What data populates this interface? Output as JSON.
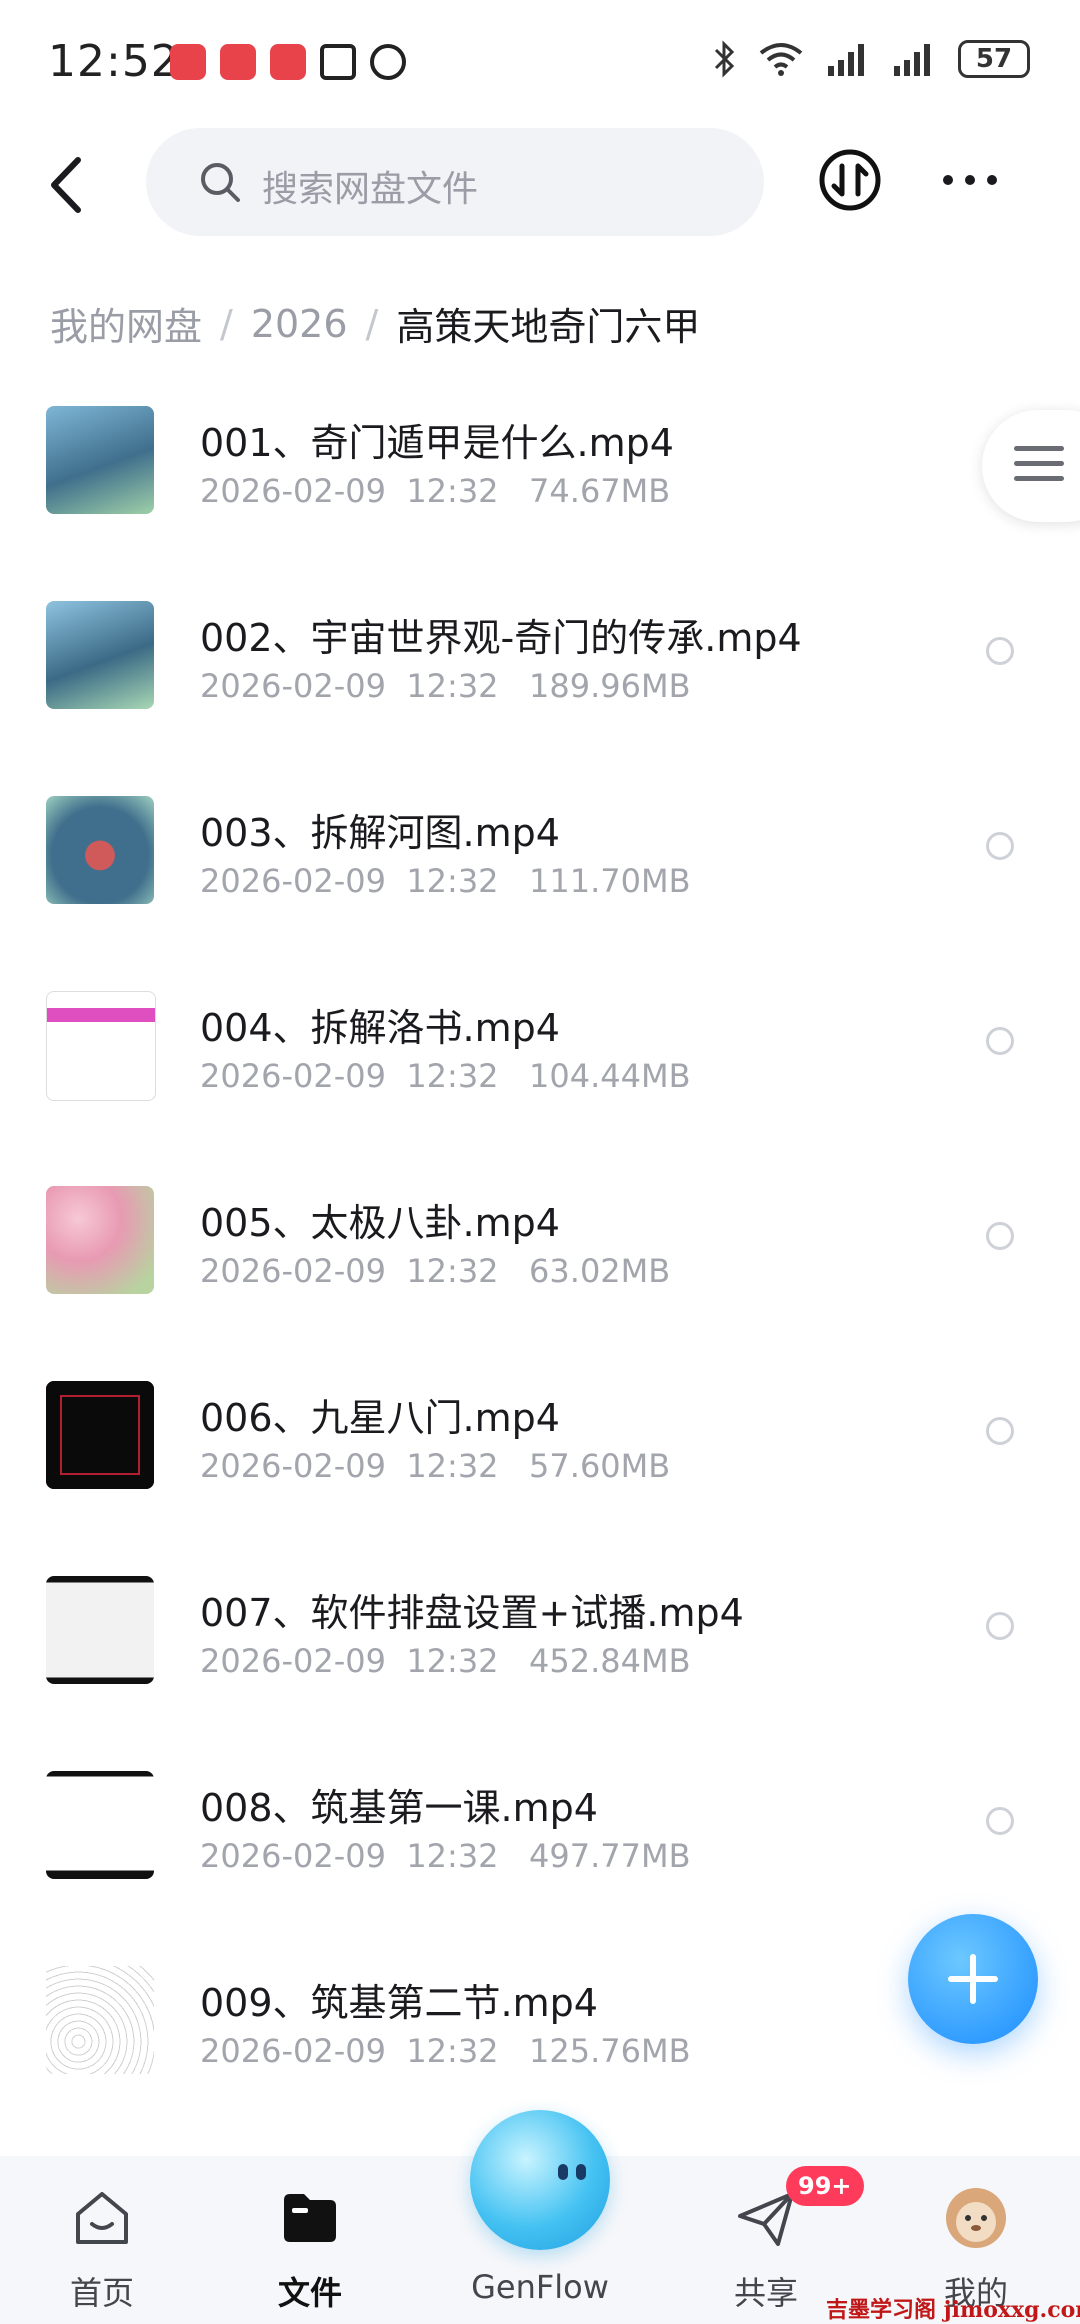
{
  "status_bar": {
    "time": "12:52",
    "battery": "57",
    "icons": [
      "bluetooth-icon",
      "wifi-icon",
      "signal-icon",
      "signal-icon",
      "battery-icon"
    ]
  },
  "top_bar": {
    "search_placeholder": "搜索网盘文件",
    "icons": [
      "back-icon",
      "search-icon",
      "transfer-icon",
      "more-icon"
    ]
  },
  "breadcrumb": {
    "items": [
      "我的网盘",
      "2026",
      "高策天地奇门六甲"
    ],
    "separator": "/"
  },
  "files": [
    {
      "name": "001、奇门遁甲是什么.mp4",
      "date": "2026-02-09",
      "time": "12:32",
      "size": "74.67MB"
    },
    {
      "name": "002、宇宙世界观-奇门的传承.mp4",
      "date": "2026-02-09",
      "time": "12:32",
      "size": "189.96MB"
    },
    {
      "name": "003、拆解河图.mp4",
      "date": "2026-02-09",
      "time": "12:32",
      "size": "111.70MB"
    },
    {
      "name": "004、拆解洛书.mp4",
      "date": "2026-02-09",
      "time": "12:32",
      "size": "104.44MB"
    },
    {
      "name": "005、太极八卦.mp4",
      "date": "2026-02-09",
      "time": "12:32",
      "size": "63.02MB"
    },
    {
      "name": "006、九星八门.mp4",
      "date": "2026-02-09",
      "time": "12:32",
      "size": "57.60MB"
    },
    {
      "name": "007、软件排盘设置+试播.mp4",
      "date": "2026-02-09",
      "time": "12:32",
      "size": "452.84MB"
    },
    {
      "name": "008、筑基第一课.mp4",
      "date": "2026-02-09",
      "time": "12:32",
      "size": "497.77MB"
    },
    {
      "name": "009、筑基第二节.mp4",
      "date": "2026-02-09",
      "time": "12:32",
      "size": "125.76MB"
    }
  ],
  "bottom_nav": {
    "items": [
      {
        "label": "首页",
        "icon": "home-icon"
      },
      {
        "label": "文件",
        "icon": "folder-icon",
        "active": true
      },
      {
        "label": "GenFlow",
        "icon": "genflow-orb-icon"
      },
      {
        "label": "共享",
        "icon": "share-icon",
        "badge": "99+"
      },
      {
        "label": "我的",
        "icon": "avatar-icon"
      }
    ]
  },
  "watermark": "吉墨学习阁 jimoxxg.com",
  "colors": {
    "accent": "#1a8cff",
    "badge": "#ff3b5c",
    "text_secondary": "#a3a5ad"
  }
}
